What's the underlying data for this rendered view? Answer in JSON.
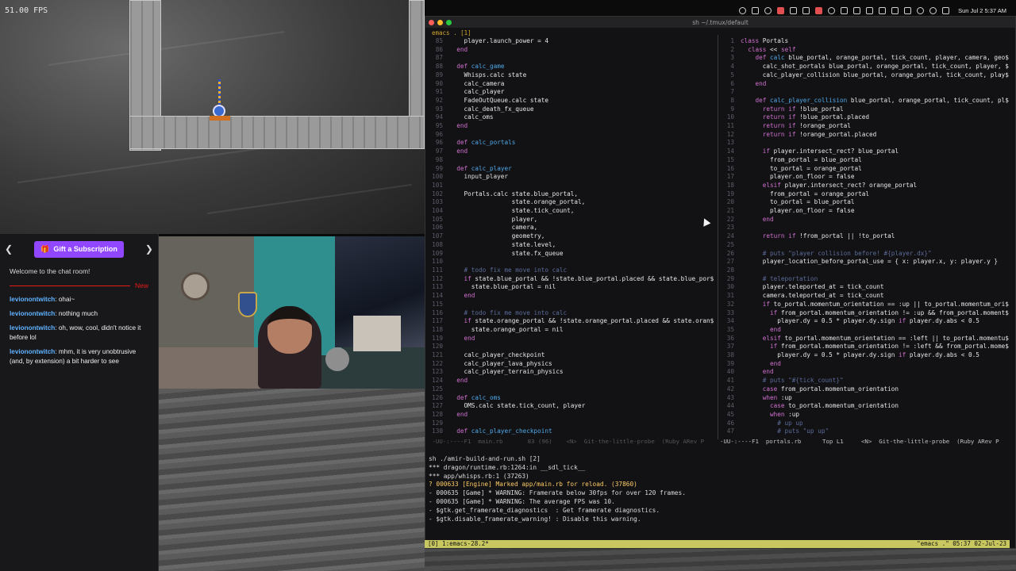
{
  "game": {
    "fps": "51.00 FPS"
  },
  "chat": {
    "gift_label": "Gift a Subscription",
    "welcome": "Welcome to the chat room!",
    "new_label": "New",
    "messages": [
      {
        "user": "levionontwitch",
        "text": ": ohai~"
      },
      {
        "user": "levionontwitch",
        "text": ": nothing much"
      },
      {
        "user": "levionontwitch",
        "text": ": oh, wow, cool, didn't notice it before lol"
      },
      {
        "user": "levionontwitch",
        "text": ": mhm, it is very unobtrusive (and, by extension) a bit harder to see"
      }
    ]
  },
  "menubar": {
    "clock": "Sun Jul 2  5:37 AM"
  },
  "window": {
    "title": "sh ~/.tmux/default",
    "emacs_header": "emacs . [1]"
  },
  "left_pane": {
    "lines": [
      {
        "n": "85",
        "t": "    player.launch_power = 4"
      },
      {
        "n": "86",
        "t": "  end"
      },
      {
        "n": "87",
        "t": ""
      },
      {
        "n": "88",
        "t": "  def calc_game"
      },
      {
        "n": "89",
        "t": "    Whisps.calc state"
      },
      {
        "n": "90",
        "t": "    calc_camera"
      },
      {
        "n": "91",
        "t": "    calc_player"
      },
      {
        "n": "92",
        "t": "    FadeOutQueue.calc state"
      },
      {
        "n": "93",
        "t": "    calc_death_fx_queue"
      },
      {
        "n": "94",
        "t": "    calc_oms"
      },
      {
        "n": "95",
        "t": "  end"
      },
      {
        "n": "96",
        "t": ""
      },
      {
        "n": "96",
        "t": "  def calc_portals"
      },
      {
        "n": "97",
        "t": "  end"
      },
      {
        "n": "98",
        "t": ""
      },
      {
        "n": "99",
        "t": "  def calc_player"
      },
      {
        "n": "100",
        "t": "    input_player"
      },
      {
        "n": "101",
        "t": ""
      },
      {
        "n": "102",
        "t": "    Portals.calc state.blue_portal,"
      },
      {
        "n": "103",
        "t": "                 state.orange_portal,"
      },
      {
        "n": "104",
        "t": "                 state.tick_count,"
      },
      {
        "n": "105",
        "t": "                 player,"
      },
      {
        "n": "106",
        "t": "                 camera,"
      },
      {
        "n": "107",
        "t": "                 geometry,"
      },
      {
        "n": "108",
        "t": "                 state.level,"
      },
      {
        "n": "109",
        "t": "                 state.fx_queue"
      },
      {
        "n": "110",
        "t": ""
      },
      {
        "n": "111",
        "t": "    # todo fix me move into calc"
      },
      {
        "n": "112",
        "t": "    if state.blue_portal && !state.blue_portal.placed && state.blue_por$"
      },
      {
        "n": "113",
        "t": "      state.blue_portal = nil"
      },
      {
        "n": "114",
        "t": "    end"
      },
      {
        "n": "115",
        "t": ""
      },
      {
        "n": "116",
        "t": "    # todo fix me move into calc"
      },
      {
        "n": "117",
        "t": "    if state.orange_portal && !state.orange_portal.placed && state.oran$"
      },
      {
        "n": "118",
        "t": "      state.orange_portal = nil"
      },
      {
        "n": "119",
        "t": "    end"
      },
      {
        "n": "120",
        "t": ""
      },
      {
        "n": "121",
        "t": "    calc_player_checkpoint"
      },
      {
        "n": "122",
        "t": "    calc_player_lava_physics"
      },
      {
        "n": "123",
        "t": "    calc_player_terrain_physics"
      },
      {
        "n": "124",
        "t": "  end"
      },
      {
        "n": "125",
        "t": ""
      },
      {
        "n": "126",
        "t": "  def calc_oms"
      },
      {
        "n": "127",
        "t": "    OMS.calc state.tick_count, player"
      },
      {
        "n": "128",
        "t": "  end"
      },
      {
        "n": "129",
        "t": ""
      },
      {
        "n": "130",
        "t": "  def calc_player_checkpoint"
      }
    ],
    "modeline": " -UU-:----F1  main.rb       83 (96)    <N>  Git-the-little-probe  (Ruby ARev P"
  },
  "right_pane": {
    "lines": [
      {
        "n": "1",
        "t": "class Portals"
      },
      {
        "n": "2",
        "t": "  class << self"
      },
      {
        "n": "3",
        "t": "    def calc blue_portal, orange_portal, tick_count, player, camera, geo$"
      },
      {
        "n": "4",
        "t": "      calc_shot_portals blue_portal, orange_portal, tick_count, player, $"
      },
      {
        "n": "5",
        "t": "      calc_player_collision blue_portal, orange_portal, tick_count, play$"
      },
      {
        "n": "6",
        "t": "    end"
      },
      {
        "n": "7",
        "t": ""
      },
      {
        "n": "8",
        "t": "    def calc_player_collision blue_portal, orange_portal, tick_count, pl$"
      },
      {
        "n": "9",
        "t": "      return if !blue_portal"
      },
      {
        "n": "10",
        "t": "      return if !blue_portal.placed"
      },
      {
        "n": "11",
        "t": "      return if !orange_portal"
      },
      {
        "n": "12",
        "t": "      return if !orange_portal.placed"
      },
      {
        "n": "13",
        "t": ""
      },
      {
        "n": "14",
        "t": "      if player.intersect_rect? blue_portal"
      },
      {
        "n": "15",
        "t": "        from_portal = blue_portal"
      },
      {
        "n": "16",
        "t": "        to_portal = orange_portal"
      },
      {
        "n": "17",
        "t": "        player.on_floor = false"
      },
      {
        "n": "18",
        "t": "      elsif player.intersect_rect? orange_portal"
      },
      {
        "n": "19",
        "t": "        from_portal = orange_portal"
      },
      {
        "n": "20",
        "t": "        to_portal = blue_portal"
      },
      {
        "n": "21",
        "t": "        player.on_floor = false"
      },
      {
        "n": "22",
        "t": "      end"
      },
      {
        "n": "23",
        "t": ""
      },
      {
        "n": "24",
        "t": "      return if !from_portal || !to_portal"
      },
      {
        "n": "25",
        "t": ""
      },
      {
        "n": "26",
        "t": "      # puts \"player collision before! #{player.dx}\""
      },
      {
        "n": "27",
        "t": "      player_location_before_portal_use = { x: player.x, y: player.y }"
      },
      {
        "n": "28",
        "t": ""
      },
      {
        "n": "29",
        "t": "      # teleportation"
      },
      {
        "n": "30",
        "t": "      player.teleported_at = tick_count"
      },
      {
        "n": "31",
        "t": "      camera.teleported_at = tick_count"
      },
      {
        "n": "32",
        "t": "      if to_portal.momentum_orientation == :up || to_portal.momentum_ori$"
      },
      {
        "n": "33",
        "t": "        if from_portal.momentum_orientation != :up && from_portal.moment$"
      },
      {
        "n": "34",
        "t": "          player.dy = 0.5 * player.dy.sign if player.dy.abs < 0.5"
      },
      {
        "n": "35",
        "t": "        end"
      },
      {
        "n": "36",
        "t": "      elsif to_portal.momentum_orientation == :left || to_portal.momentu$"
      },
      {
        "n": "37",
        "t": "        if from_portal.momentum_orientation != :left && from_portal.mome$"
      },
      {
        "n": "38",
        "t": "          player.dy = 0.5 * player.dy.sign if player.dy.abs < 0.5"
      },
      {
        "n": "39",
        "t": "        end"
      },
      {
        "n": "40",
        "t": "      end"
      },
      {
        "n": "41",
        "t": "      # puts \"#{tick_count}\""
      },
      {
        "n": "42",
        "t": "      case from_portal.momentum_orientation"
      },
      {
        "n": "43",
        "t": "      when :up"
      },
      {
        "n": "44",
        "t": "        case to_portal.momentum_orientation"
      },
      {
        "n": "45",
        "t": "        when :up"
      },
      {
        "n": "46",
        "t": "          # up up"
      },
      {
        "n": "47",
        "t": "          # puts \"up up\""
      }
    ],
    "modeline": "-UU-:----F1  portals.rb      Top L1     <N>  Git-the-little-probe  (Ruby ARev P"
  },
  "shell": {
    "lines": [
      "sh ./amir-build-and-run.sh [2]",
      "*** dragon/runtime.rb:1264:in __sdl_tick__",
      "*** app/whisps.rb:1 (37263)",
      "? 000633 [Engine] Marked app/main.rb for reload. (37860)",
      "- 000635 [Game] * WARNING: Framerate below 30fps for over 120 frames.",
      "- 000635 [Game] * WARNING: The average FPS was 10.",
      "- $gtk.get_framerate_diagnostics  : Get framerate diagnostics.",
      "- $gtk.disable_framerate_warning! : Disable this warning."
    ]
  },
  "tmux": {
    "left": "[0] 1:emacs-28.2*",
    "right": "\"emacs .\" 05:37 02-Jul-23"
  }
}
